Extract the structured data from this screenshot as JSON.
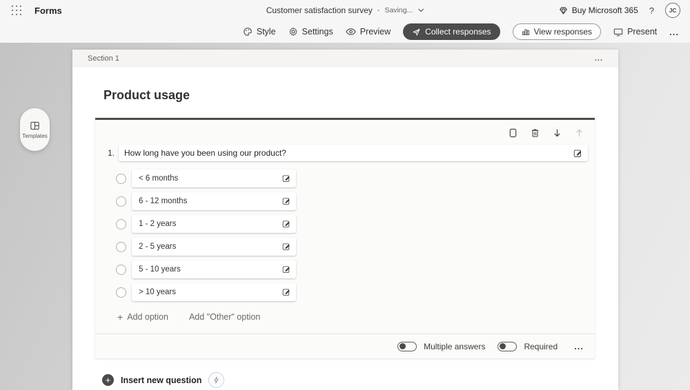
{
  "topbar": {
    "app_name": "Forms",
    "doc_title": "Customer satisfaction survey",
    "separator": "-",
    "save_status": "Saving...",
    "buy_label": "Buy Microsoft 365",
    "help_label": "?",
    "avatar_initials": "JC"
  },
  "toolbar": {
    "style_label": "Style",
    "settings_label": "Settings",
    "preview_label": "Preview",
    "collect_label": "Collect responses",
    "view_responses_label": "View responses",
    "present_label": "Present",
    "more_label": "..."
  },
  "sidebar": {
    "templates_label": "Templates"
  },
  "canvas": {
    "section_label": "Section 1",
    "section_more": "...",
    "form_title": "Product usage",
    "question": {
      "number": "1.",
      "text": "How long have you been using our product?",
      "options": [
        "< 6 months",
        "6 - 12 months",
        "1 - 2 years",
        "2 - 5 years",
        "5 - 10 years",
        "> 10 years"
      ],
      "add_option_plus": "+",
      "add_option_label": "Add option",
      "add_other_label": "Add \"Other\" option",
      "multiple_answers_label": "Multiple answers",
      "required_label": "Required",
      "more": "..."
    },
    "insert_plus": "+",
    "insert_new_question_label": "Insert new question"
  },
  "colors": {
    "accent_dark": "#4c4c4c",
    "card_border_top": "#4e4d4c",
    "workspace_gray": "#d6d6d6"
  }
}
